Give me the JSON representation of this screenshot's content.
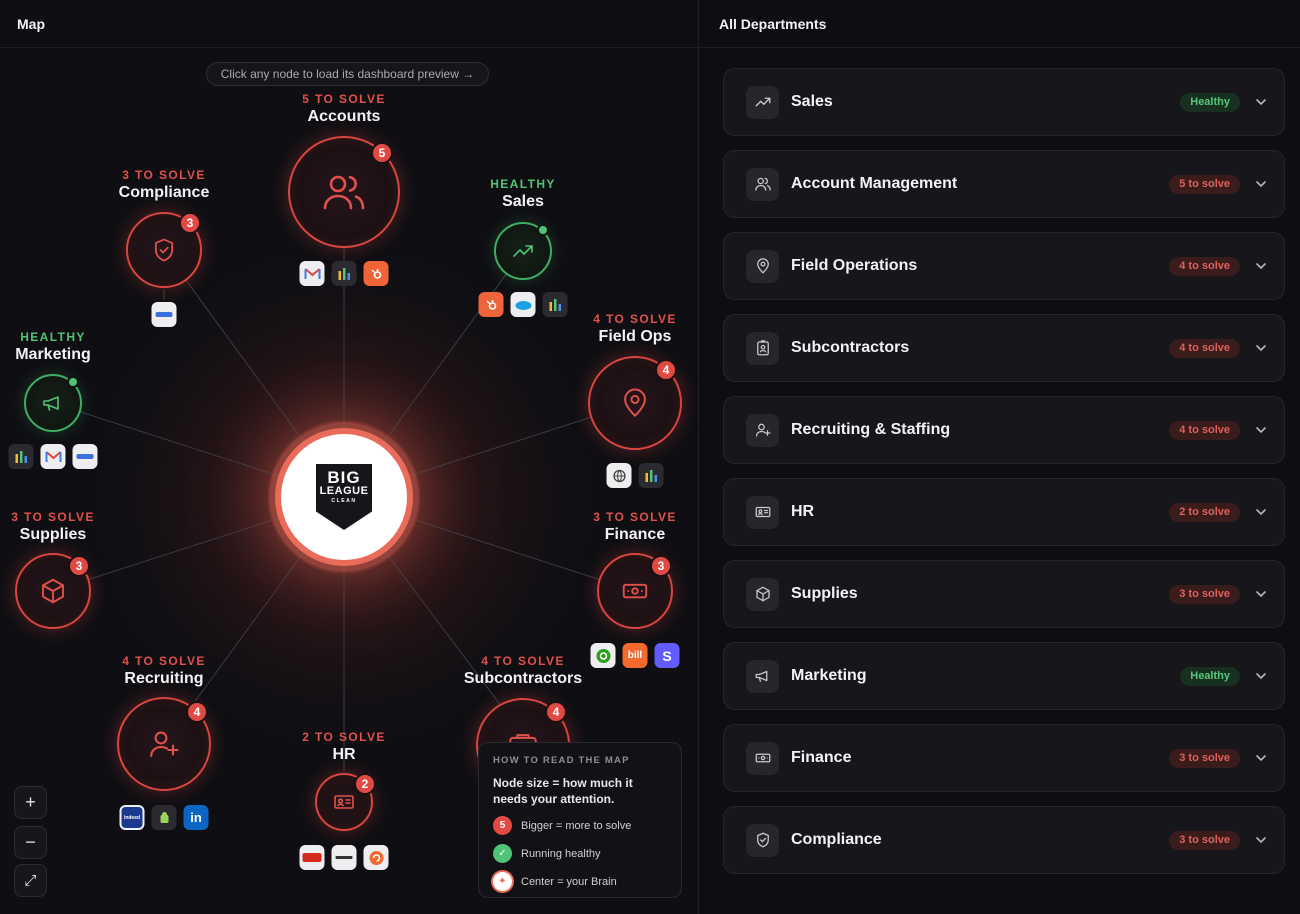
{
  "map": {
    "title": "Map",
    "hint": "Click any node to load its dashboard preview →",
    "center_logo": {
      "line1": "BIG",
      "line2": "LEAGUE",
      "line3": "CLEAN"
    },
    "nodes": {
      "accounts": {
        "status": "5 TO SOLVE",
        "name": "Accounts",
        "badge": "5"
      },
      "compliance": {
        "status": "3 TO SOLVE",
        "name": "Compliance",
        "badge": "3"
      },
      "sales": {
        "status": "HEALTHY",
        "name": "Sales"
      },
      "marketing": {
        "status": "HEALTHY",
        "name": "Marketing"
      },
      "field_ops": {
        "status": "4 TO SOLVE",
        "name": "Field Ops",
        "badge": "4"
      },
      "supplies": {
        "status": "3 TO SOLVE",
        "name": "Supplies",
        "badge": "3"
      },
      "finance": {
        "status": "3 TO SOLVE",
        "name": "Finance",
        "badge": "3"
      },
      "recruiting": {
        "status": "4 TO SOLVE",
        "name": "Recruiting",
        "badge": "4"
      },
      "hr": {
        "status": "2 TO SOLVE",
        "name": "HR",
        "badge": "2"
      },
      "subcontractors": {
        "status": "4 TO SOLVE",
        "name": "Subcontractors",
        "badge": "4"
      }
    },
    "tiles": {
      "bill": "bill",
      "stripe": "S",
      "linkedin": "in",
      "indeed": "indeed"
    },
    "zoom": {
      "in": "+",
      "out": "−",
      "fit": "⤢"
    },
    "legend": {
      "title": "HOW TO READ THE MAP",
      "description": "Node size = how much it needs your attention.",
      "rows": [
        {
          "marker": "5",
          "text": "Bigger = more to solve"
        },
        {
          "marker": "✓",
          "text": "Running healthy"
        },
        {
          "marker": "✦",
          "text": "Center = your Brain"
        }
      ]
    }
  },
  "departments": {
    "title": "All Departments",
    "items": [
      {
        "name": "Sales",
        "status": "Healthy",
        "icon": "trending-up-icon"
      },
      {
        "name": "Account Management",
        "status": "5 to solve",
        "icon": "users-icon"
      },
      {
        "name": "Field Operations",
        "status": "4 to solve",
        "icon": "map-pin-icon"
      },
      {
        "name": "Subcontractors",
        "status": "4 to solve",
        "icon": "badge-id-icon"
      },
      {
        "name": "Recruiting & Staffing",
        "status": "4 to solve",
        "icon": "user-plus-icon"
      },
      {
        "name": "HR",
        "status": "2 to solve",
        "icon": "id-card-icon"
      },
      {
        "name": "Supplies",
        "status": "3 to solve",
        "icon": "box-icon"
      },
      {
        "name": "Marketing",
        "status": "Healthy",
        "icon": "megaphone-icon"
      },
      {
        "name": "Finance",
        "status": "3 to solve",
        "icon": "banknote-icon"
      },
      {
        "name": "Compliance",
        "status": "3 to solve",
        "icon": "shield-icon"
      }
    ]
  },
  "colors": {
    "bad": "#e14a43",
    "good": "#4fc476",
    "accent_glow": "#e96b5a",
    "background": "#0f0f13"
  }
}
